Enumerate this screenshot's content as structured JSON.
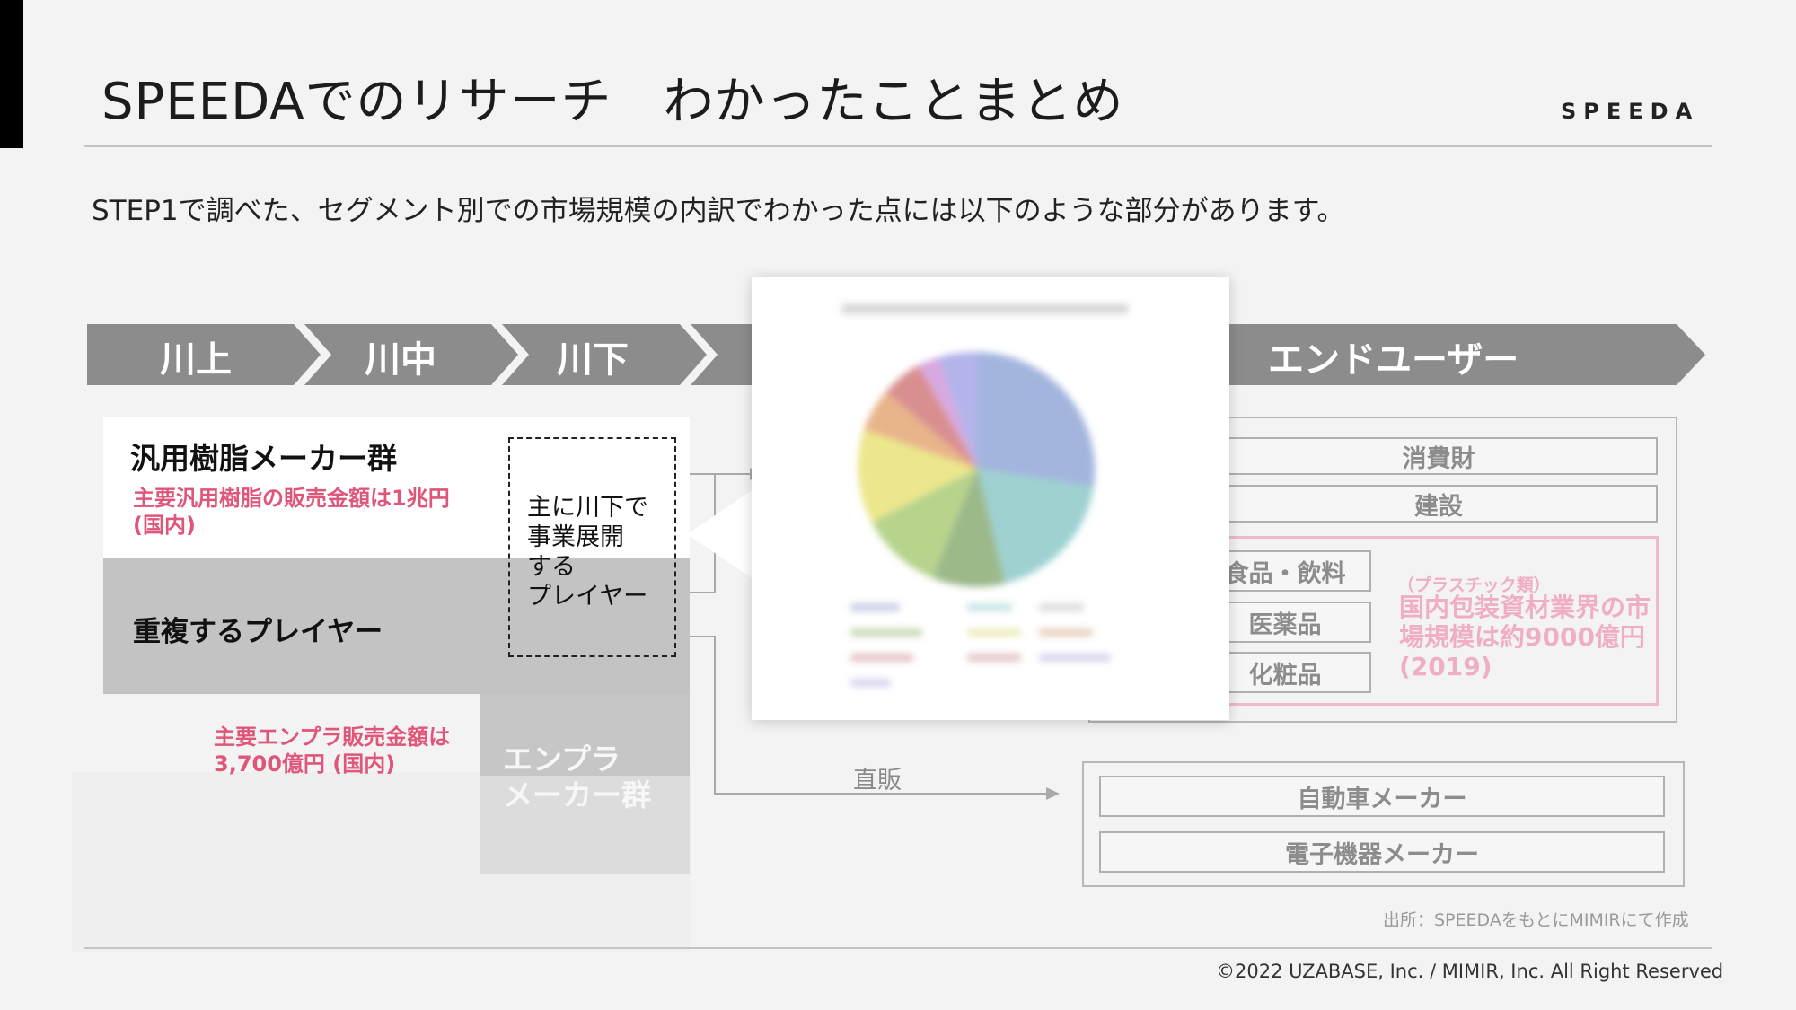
{
  "header": {
    "title": "SPEEDAでのリサーチ　わかったことまとめ",
    "brand": "SPEEDA"
  },
  "intro": "STEP1で調べた、セグメント別での市場規模の内訳でわかった点には以下のような部分があります。",
  "flow": {
    "stages": [
      "川上",
      "川中",
      "川下",
      "エンドユーザー"
    ]
  },
  "left": {
    "general_resin_title": "汎用樹脂メーカー群",
    "general_resin_note": "主要汎用樹脂の販売金額は1兆円(国内)",
    "overlap_title": "重複するプレイヤー",
    "downstream_lines": [
      "主に川下で",
      "事業展開",
      "する",
      "プレイヤー"
    ],
    "enpla_note_line1": "主要エンプラ販売金額は",
    "enpla_note_line2": "3,700億円 (国内)",
    "enpla_title_line1": "エンプラ",
    "enpla_title_line2": "メーカー群"
  },
  "end_user": {
    "consumer_items": [
      "消費財",
      "建設",
      "食品・飲料",
      "医薬品",
      "化粧品"
    ],
    "packaging_note_small": "（プラスチック類）",
    "packaging_note": "国内包装資材業界の市場規模は約9000億円(2019)",
    "direct_label": "直販",
    "direct_items": [
      "自動車メーカー",
      "電子機器メーカー"
    ]
  },
  "footer": {
    "source": "出所：SPEEDAをもとにMIMIRにて作成",
    "copyright": "©2022 UZABASE, Inc. / MIMIR, Inc. All Right Reserved"
  },
  "colors": {
    "pink_accent": "#e0567a",
    "pink_light": "#f0aec4",
    "chevron_gray": "#8c8c8c"
  }
}
